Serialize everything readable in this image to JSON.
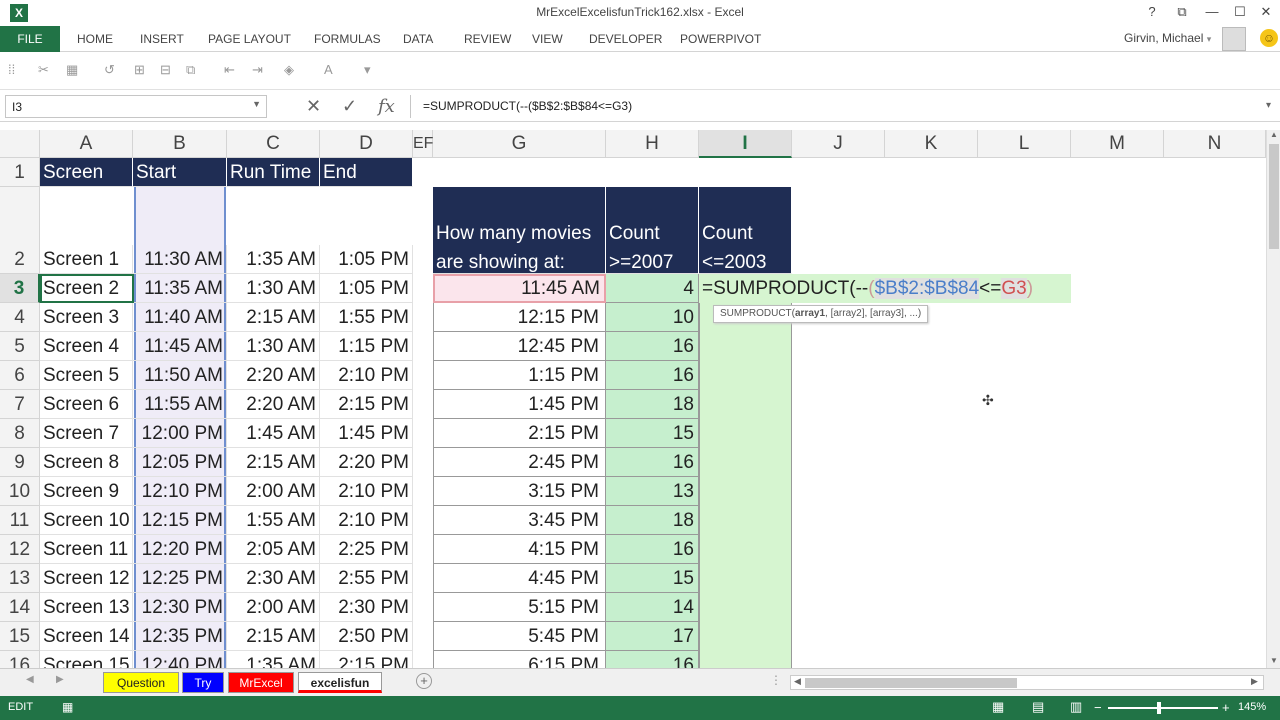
{
  "window": {
    "title": "MrExcelExcelisfunTrick162.xlsx - Excel",
    "help": "?",
    "restore": "⧉",
    "minimize": "—",
    "maximize": "☐",
    "close": "✕"
  },
  "ribbon": {
    "file": "FILE",
    "tabs": [
      "HOME",
      "INSERT",
      "PAGE LAYOUT",
      "FORMULAS",
      "DATA",
      "REVIEW",
      "VIEW",
      "DEVELOPER",
      "POWERPIVOT"
    ],
    "user": "Girvin, Michael",
    "user_arrow": "▾"
  },
  "formula_bar": {
    "name_box": "I3",
    "formula": "=SUMPRODUCT(--($B$2:$B$84<=G3)"
  },
  "columns": [
    "A",
    "B",
    "C",
    "D",
    "EF",
    "G",
    "H",
    "I",
    "J",
    "K",
    "L",
    "M",
    "N"
  ],
  "rows": [
    "1",
    "2",
    "3",
    "4",
    "5",
    "6",
    "7",
    "8",
    "9",
    "10",
    "11",
    "12",
    "13",
    "14",
    "15",
    "16"
  ],
  "table_headers": {
    "a": "Screen",
    "b": "Start",
    "c": "Run Time",
    "d": "End"
  },
  "screens": [
    {
      "screen": "Screen 1",
      "start": "11:30 AM",
      "run": "1:35 AM",
      "end": "1:05 PM"
    },
    {
      "screen": "Screen 2",
      "start": "11:35 AM",
      "run": "1:30 AM",
      "end": "1:05 PM"
    },
    {
      "screen": "Screen 3",
      "start": "11:40 AM",
      "run": "2:15 AM",
      "end": "1:55 PM"
    },
    {
      "screen": "Screen 4",
      "start": "11:45 AM",
      "run": "1:30 AM",
      "end": "1:15 PM"
    },
    {
      "screen": "Screen 5",
      "start": "11:50 AM",
      "run": "2:20 AM",
      "end": "2:10 PM"
    },
    {
      "screen": "Screen 6",
      "start": "11:55 AM",
      "run": "2:20 AM",
      "end": "2:15 PM"
    },
    {
      "screen": "Screen 7",
      "start": "12:00 PM",
      "run": "1:45 AM",
      "end": "1:45 PM"
    },
    {
      "screen": "Screen 8",
      "start": "12:05 PM",
      "run": "2:15 AM",
      "end": "2:20 PM"
    },
    {
      "screen": "Screen 9",
      "start": "12:10 PM",
      "run": "2:00 AM",
      "end": "2:10 PM"
    },
    {
      "screen": "Screen 10",
      "start": "12:15 PM",
      "run": "1:55 AM",
      "end": "2:10 PM"
    },
    {
      "screen": "Screen 11",
      "start": "12:20 PM",
      "run": "2:05 AM",
      "end": "2:25 PM"
    },
    {
      "screen": "Screen 12",
      "start": "12:25 PM",
      "run": "2:30 AM",
      "end": "2:55 PM"
    },
    {
      "screen": "Screen 13",
      "start": "12:30 PM",
      "run": "2:00 AM",
      "end": "2:30 PM"
    },
    {
      "screen": "Screen 14",
      "start": "12:35 PM",
      "run": "2:15 AM",
      "end": "2:50 PM"
    },
    {
      "screen": "Screen 15",
      "start": "12:40 PM",
      "run": "1:35 AM",
      "end": "2:15 PM"
    }
  ],
  "question_headers": {
    "g_line1": "How many movies",
    "g_line2": "are showing at:",
    "h_line1": "Count",
    "h_line2": ">=2007",
    "i_line1": "Count",
    "i_line2": "<=2003"
  },
  "times": [
    {
      "time": "11:45 AM",
      "count": "4"
    },
    {
      "time": "12:15 PM",
      "count": "10"
    },
    {
      "time": "12:45 PM",
      "count": "16"
    },
    {
      "time": "1:15 PM",
      "count": "16"
    },
    {
      "time": "1:45 PM",
      "count": "18"
    },
    {
      "time": "2:15 PM",
      "count": "15"
    },
    {
      "time": "2:45 PM",
      "count": "16"
    },
    {
      "time": "3:15 PM",
      "count": "13"
    },
    {
      "time": "3:45 PM",
      "count": "18"
    },
    {
      "time": "4:15 PM",
      "count": "16"
    },
    {
      "time": "4:45 PM",
      "count": "15"
    },
    {
      "time": "5:15 PM",
      "count": "14"
    },
    {
      "time": "5:45 PM",
      "count": "17"
    },
    {
      "time": "6:15 PM",
      "count": "16"
    }
  ],
  "edit_cell": {
    "p1": "=SUMPRODUCT(--",
    "p2": "(",
    "p3": "$B$2:$B$84",
    "p4": "<=",
    "p5": "G3",
    "p6": ")"
  },
  "tooltip": {
    "fn": "SUMPRODUCT(",
    "arg1": "array1",
    "rest": ", [array2], [array3], ...)"
  },
  "sheet_tabs": [
    {
      "label": "Question",
      "bg": "#ffff00",
      "color": "#222"
    },
    {
      "label": "Try",
      "bg": "#0000ff",
      "color": "#fff"
    },
    {
      "label": "MrExcel",
      "bg": "#ff0000",
      "color": "#fff"
    },
    {
      "label": "excelisfun",
      "bg": "#ffffff",
      "color": "#222"
    }
  ],
  "status": {
    "mode": "EDIT",
    "zoom": "145%"
  },
  "colors": {
    "accent": "#217346",
    "header_navy": "#1f2d54",
    "count_green": "#c6efce"
  }
}
